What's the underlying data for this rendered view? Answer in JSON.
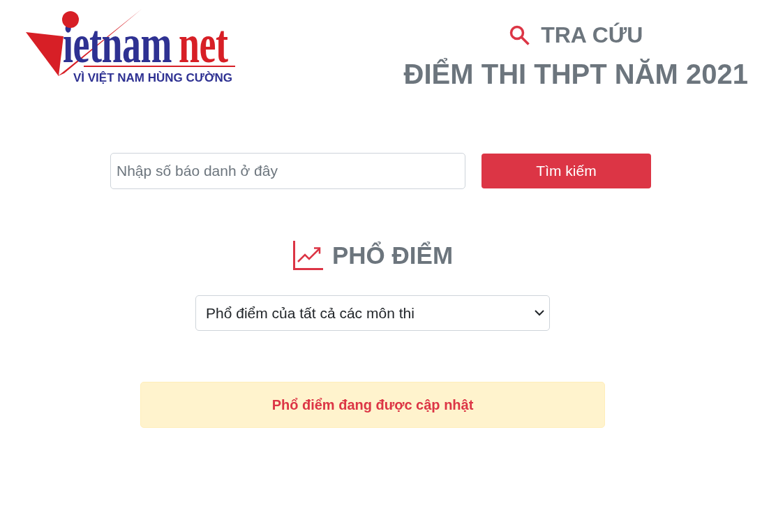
{
  "logo": {
    "wordmark": "ietnam",
    "wordmark_accent": "net",
    "tagline": "VÌ VIỆT NAM HÙNG CƯỜNG"
  },
  "header": {
    "label": "TRA CỨU",
    "title": "ĐIỂM THI THPT NĂM 2021"
  },
  "search": {
    "placeholder": "Nhập số báo danh ở đây",
    "button": "Tìm kiếm"
  },
  "distribution": {
    "heading": "PHỔ ĐIỂM",
    "dropdown_value": "Phổ điểm của tất cả các môn thi",
    "notice": "Phổ điểm đang được cập nhật"
  }
}
